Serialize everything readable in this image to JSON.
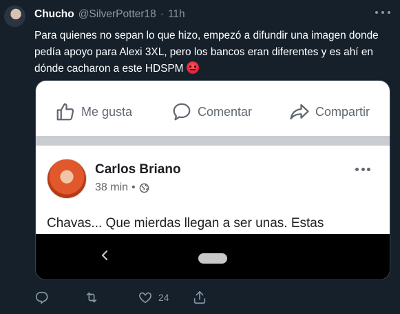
{
  "tweet": {
    "author_name": "Chucho",
    "author_handle": "@SilverPotter18",
    "separator": "·",
    "time": "11h",
    "text": "Para quienes no sepan lo que hizo, empezó a difundir una imagen donde pedía apoyo para Alexi 3XL, pero los bancos eran diferentes y es ahí en dónde cacharon a este HDSPM",
    "like_count": "24"
  },
  "media": {
    "actions": {
      "like": "Me gusta",
      "comment": "Comentar",
      "share": "Compartir"
    },
    "post": {
      "author": "Carlos Briano",
      "time": "38 min",
      "separator": "•",
      "body": "Chavas... Que mierdas llegan a ser unas. Estas"
    }
  },
  "colors": {
    "background": "#15202b",
    "secondary_text": "#8899a6",
    "primary_text": "#ffffff"
  }
}
